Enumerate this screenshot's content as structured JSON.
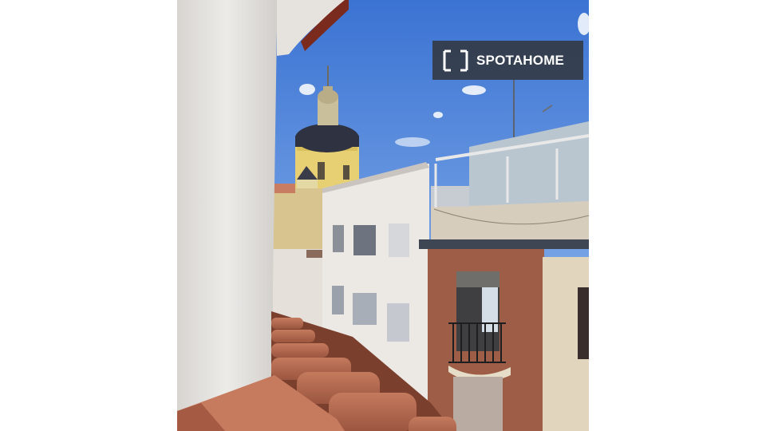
{
  "image": {
    "description_free": true
  },
  "watermark": {
    "brand": "SPOTAHOME",
    "icon": "bracket-square-icon",
    "background": "#323840",
    "text_color": "#ffffff"
  },
  "colors": {
    "sky_top": "#3f78d6",
    "sky_bottom": "#a9c7ee",
    "stucco": "#e9e6e2",
    "roof_tile": "#b8694f",
    "dome": "#2f3443",
    "church_yellow": "#e9d27a",
    "brick": "#9a5a45"
  }
}
